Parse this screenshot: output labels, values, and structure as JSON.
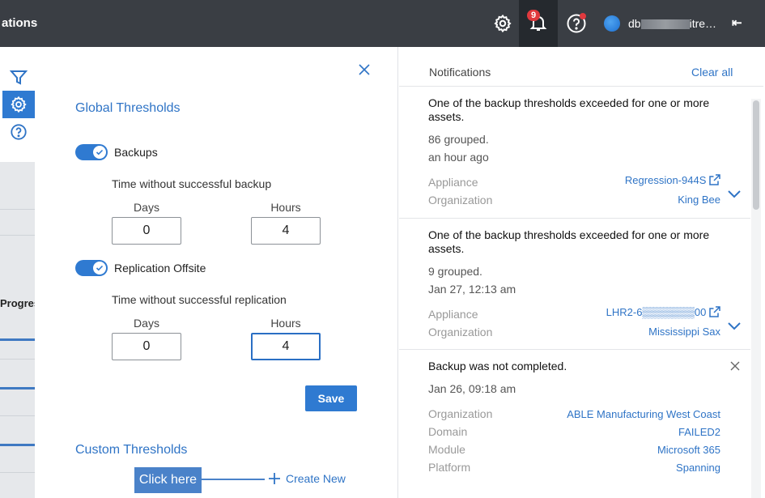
{
  "topbar": {
    "app_title": "ations",
    "notification_count": "9",
    "user_name_prefix": "db",
    "user_name_suffix": "itre…",
    "collapse_glyph": "⇤"
  },
  "left": {
    "progress_label": "Progres"
  },
  "thresholds": {
    "global_title": "Global Thresholds",
    "backups": {
      "label": "Backups",
      "enabled": true,
      "sub_label": "Time without successful backup",
      "days_label": "Days",
      "days_value": "0",
      "hours_label": "Hours",
      "hours_value": "4"
    },
    "replication": {
      "label": "Replication Offsite",
      "enabled": true,
      "sub_label": "Time without successful replication",
      "days_label": "Days",
      "days_value": "0",
      "hours_label": "Hours",
      "hours_value": "4"
    },
    "save_label": "Save",
    "custom_title": "Custom Thresholds",
    "callout": "Click here",
    "create_new": "Create New"
  },
  "notifications": {
    "title": "Notifications",
    "clear_all": "Clear all",
    "items": [
      {
        "message": "One of the backup thresholds exceeded for one or more assets.",
        "grouped": "86 grouped.",
        "time": "an hour ago",
        "fields": [
          {
            "key": "Appliance",
            "value": "Regression-944S"
          },
          {
            "key": "Organization",
            "value": "King Bee"
          }
        ]
      },
      {
        "message": "One of the backup thresholds exceeded for one or more assets.",
        "grouped": "9 grouped.",
        "time": "Jan 27, 12:13 am",
        "fields": [
          {
            "key": "Appliance",
            "value": "LHR2-6▒▒▒▒▒▒▒00"
          },
          {
            "key": "Organization",
            "value": "Mississippi Sax"
          }
        ]
      },
      {
        "message": "Backup was not completed.",
        "time": "Jan 26, 09:18 am",
        "fields": [
          {
            "key": "Organization",
            "value": "ABLE Manufacturing West Coast"
          },
          {
            "key": "Domain",
            "value": "FAILED2"
          },
          {
            "key": "Module",
            "value": "Microsoft 365"
          },
          {
            "key": "Platform",
            "value": "Spanning"
          }
        ]
      }
    ]
  },
  "colors": {
    "accent": "#2f7ad1",
    "topbar": "#3a3e44",
    "badge": "#e0393e"
  }
}
